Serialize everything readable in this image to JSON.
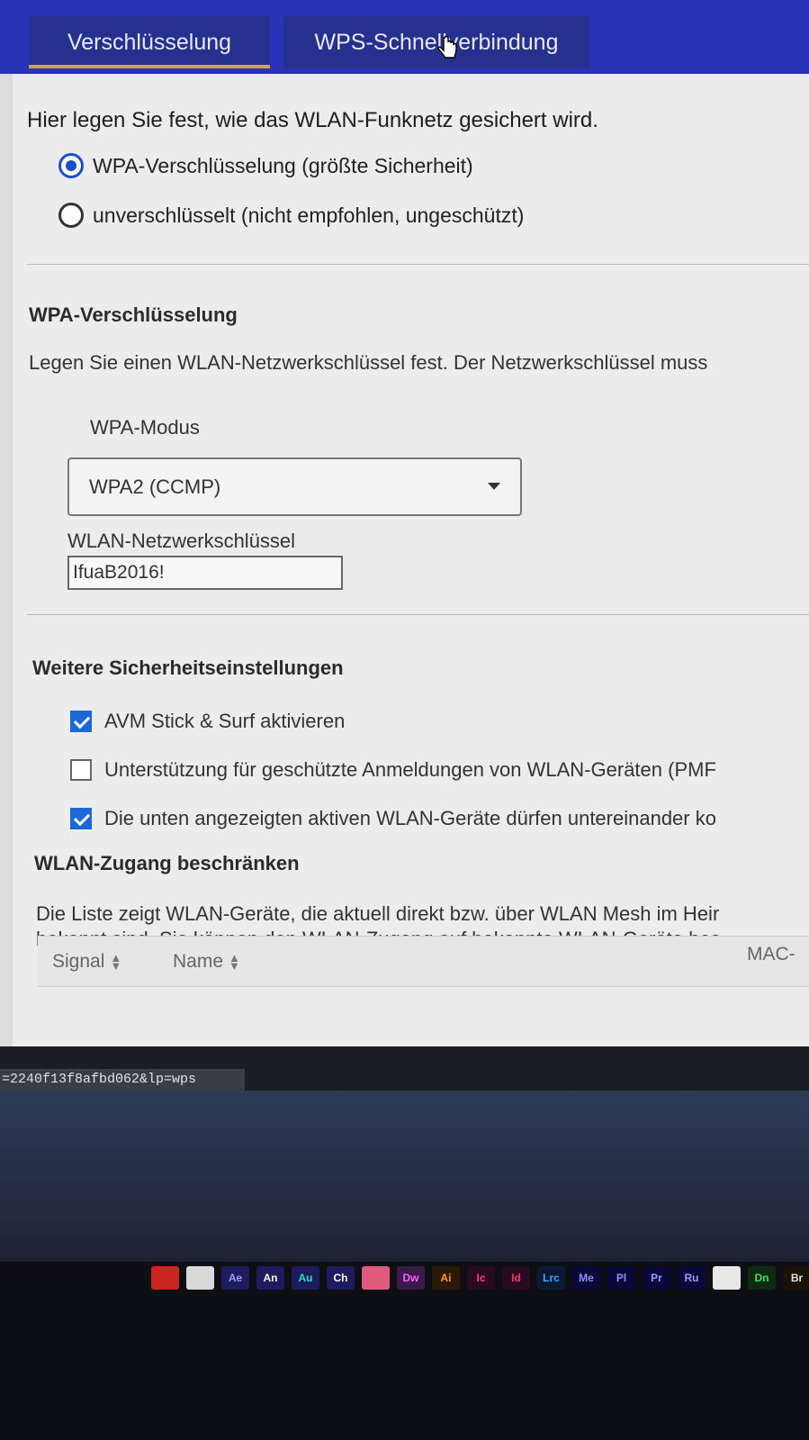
{
  "tabs": [
    {
      "label": "Verschlüsselung",
      "active": true
    },
    {
      "label": "WPS-Schnellverbindung",
      "active": false
    }
  ],
  "security": {
    "intro": "Hier legen Sie fest, wie das WLAN-Funknetz gesichert wird.",
    "options": [
      {
        "label": "WPA-Verschlüsselung (größte Sicherheit)",
        "selected": true
      },
      {
        "label": "unverschlüsselt (nicht empfohlen, ungeschützt)",
        "selected": false
      }
    ]
  },
  "wpa": {
    "heading": "WPA-Verschlüsselung",
    "description": "Legen Sie einen WLAN-Netzwerkschlüssel fest. Der Netzwerkschlüssel muss",
    "mode_label": "WPA-Modus",
    "mode_value": "WPA2 (CCMP)",
    "key_label": "WLAN-Netzwerkschlüssel",
    "key_value": "IfuaB2016!"
  },
  "further": {
    "heading": "Weitere Sicherheitseinstellungen",
    "checks": [
      {
        "label": "AVM Stick & Surf aktivieren",
        "checked": true
      },
      {
        "label": "Unterstützung für geschützte Anmeldungen von WLAN-Geräten (PMF",
        "checked": false
      },
      {
        "label": "Die unten angezeigten aktiven WLAN-Geräte dürfen untereinander ko",
        "checked": true
      }
    ]
  },
  "access": {
    "heading": "WLAN-Zugang beschränken",
    "line1": "Die Liste zeigt WLAN-Geräte, die aktuell direkt bzw. über WLAN Mesh im Heir",
    "line2": "bekannt sind. Sie können den WLAN-Zugang auf bekannte WLAN-Geräte bes",
    "columns": [
      "Signal",
      "Name",
      "MAC-"
    ]
  },
  "status_url": "=2240f13f8afbd062&lp=wps",
  "dock_apps": [
    {
      "label": "",
      "name": "acrobat-icon",
      "bg": "#c8261e",
      "fg": "#ffffff"
    },
    {
      "label": "",
      "name": "acrobat-reader-icon",
      "bg": "#d9d9d9",
      "fg": "#b0221c"
    },
    {
      "label": "Ae",
      "name": "after-effects-icon",
      "bg": "#1c1c5e",
      "fg": "#9c9cff"
    },
    {
      "label": "An",
      "name": "animate-icon",
      "bg": "#1c1c5e",
      "fg": "#ffffff"
    },
    {
      "label": "Au",
      "name": "audition-icon",
      "bg": "#1c1c5e",
      "fg": "#1fe3c0"
    },
    {
      "label": "Ch",
      "name": "character-animator-icon",
      "bg": "#1c1c5e",
      "fg": "#ffffff"
    },
    {
      "label": "",
      "name": "creative-cloud-icon",
      "bg": "#e25a7d",
      "fg": "#ffffff"
    },
    {
      "label": "Dw",
      "name": "dreamweaver-icon",
      "bg": "#3a1a4a",
      "fg": "#ff61f6"
    },
    {
      "label": "Ai",
      "name": "illustrator-icon",
      "bg": "#2a1a05",
      "fg": "#ff9a00"
    },
    {
      "label": "Ic",
      "name": "incopy-icon",
      "bg": "#2a0a1f",
      "fg": "#ff3f7a"
    },
    {
      "label": "Id",
      "name": "indesign-icon",
      "bg": "#2a0a1f",
      "fg": "#ff3366"
    },
    {
      "label": "Lrc",
      "name": "lightroom-classic-icon",
      "bg": "#0a1a33",
      "fg": "#31a8ff"
    },
    {
      "label": "Me",
      "name": "media-encoder-icon",
      "bg": "#0a0a3a",
      "fg": "#8c8cff"
    },
    {
      "label": "Pl",
      "name": "prelude-icon",
      "bg": "#0a0a3a",
      "fg": "#8c8cff"
    },
    {
      "label": "Pr",
      "name": "premiere-icon",
      "bg": "#0a0a3a",
      "fg": "#9999ff"
    },
    {
      "label": "Ru",
      "name": "rush-icon",
      "bg": "#0a0a3a",
      "fg": "#9999ff"
    },
    {
      "label": "",
      "name": "document-icon",
      "bg": "#e8e8e8",
      "fg": "#333333"
    },
    {
      "label": "Dn",
      "name": "dimension-icon",
      "bg": "#0f2a12",
      "fg": "#4cdf5f"
    },
    {
      "label": "Br",
      "name": "bridge-icon",
      "bg": "#1a1205",
      "fg": "#e0e0e0"
    }
  ],
  "colors": {
    "tab_bar": "#2a33b8",
    "accent": "#1b4fc9",
    "checkbox": "#1b68d6",
    "tab_underline": "#c8a640"
  }
}
